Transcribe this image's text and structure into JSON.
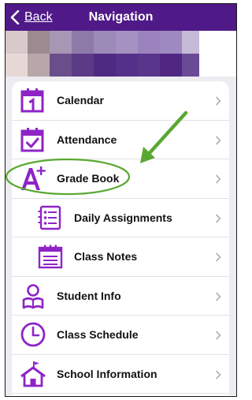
{
  "header": {
    "back_label": "Back",
    "title": "Navigation"
  },
  "colors": {
    "header_bg": "#4f1a87",
    "icon_purple": "#8e24c6",
    "annotation_green": "#5aa832"
  },
  "menu": [
    {
      "label": "Calendar",
      "icon": "calendar-icon"
    },
    {
      "label": "Attendance",
      "icon": "attendance-check-icon"
    },
    {
      "label": "Grade Book",
      "icon": "grade-a-plus-icon",
      "highlighted": true
    },
    {
      "label": "Daily Assignments",
      "icon": "checklist-icon",
      "sub": true
    },
    {
      "label": "Class Notes",
      "icon": "notepad-icon",
      "sub": true
    },
    {
      "label": "Student Info",
      "icon": "student-reading-icon"
    },
    {
      "label": "Class Schedule",
      "icon": "clock-icon"
    },
    {
      "label": "School Information",
      "icon": "school-house-icon"
    }
  ]
}
